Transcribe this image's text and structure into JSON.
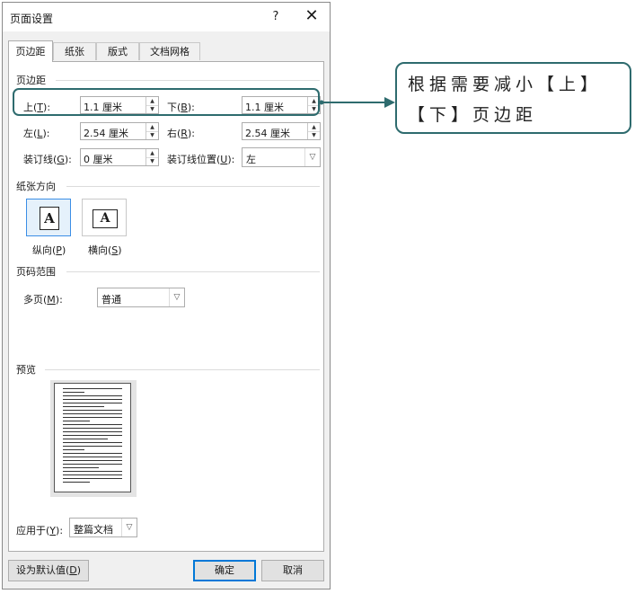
{
  "dialog": {
    "title": "页面设置",
    "help": "?",
    "close": "✕"
  },
  "tabs": [
    {
      "label": "页边距",
      "active": true
    },
    {
      "label": "纸张",
      "active": false
    },
    {
      "label": "版式",
      "active": false
    },
    {
      "label": "文档网格",
      "active": false
    }
  ],
  "margins": {
    "section_label": "页边距",
    "top": {
      "label": "上",
      "key": "T",
      "value": "1.1 厘米"
    },
    "bottom": {
      "label": "下",
      "key": "B",
      "value": "1.1 厘米"
    },
    "left": {
      "label": "左",
      "key": "L",
      "value": "2.54 厘米"
    },
    "right": {
      "label": "右",
      "key": "R",
      "value": "2.54 厘米"
    },
    "gutter": {
      "label": "装订线",
      "key": "G",
      "value": "0 厘米"
    },
    "gutter_position": {
      "label": "装订线位置",
      "key": "U",
      "value": "左"
    }
  },
  "orientation": {
    "section_label": "纸张方向",
    "portrait": {
      "label": "纵向",
      "key": "P",
      "glyph": "A"
    },
    "landscape": {
      "label": "横向",
      "key": "S",
      "glyph": "A"
    }
  },
  "pages": {
    "section_label": "页码范围",
    "multiple": {
      "label": "多页",
      "key": "M",
      "value": "普通"
    }
  },
  "preview": {
    "section_label": "预览"
  },
  "apply_to": {
    "label": "应用于",
    "key": "Y",
    "value": "整篇文档"
  },
  "buttons": {
    "set_default": "设为默认值",
    "set_default_key": "D",
    "ok": "确定",
    "cancel": "取消"
  },
  "annotation": {
    "text": "根据需要减小【上】【下】页边距",
    "color": "#2e6b6e"
  }
}
